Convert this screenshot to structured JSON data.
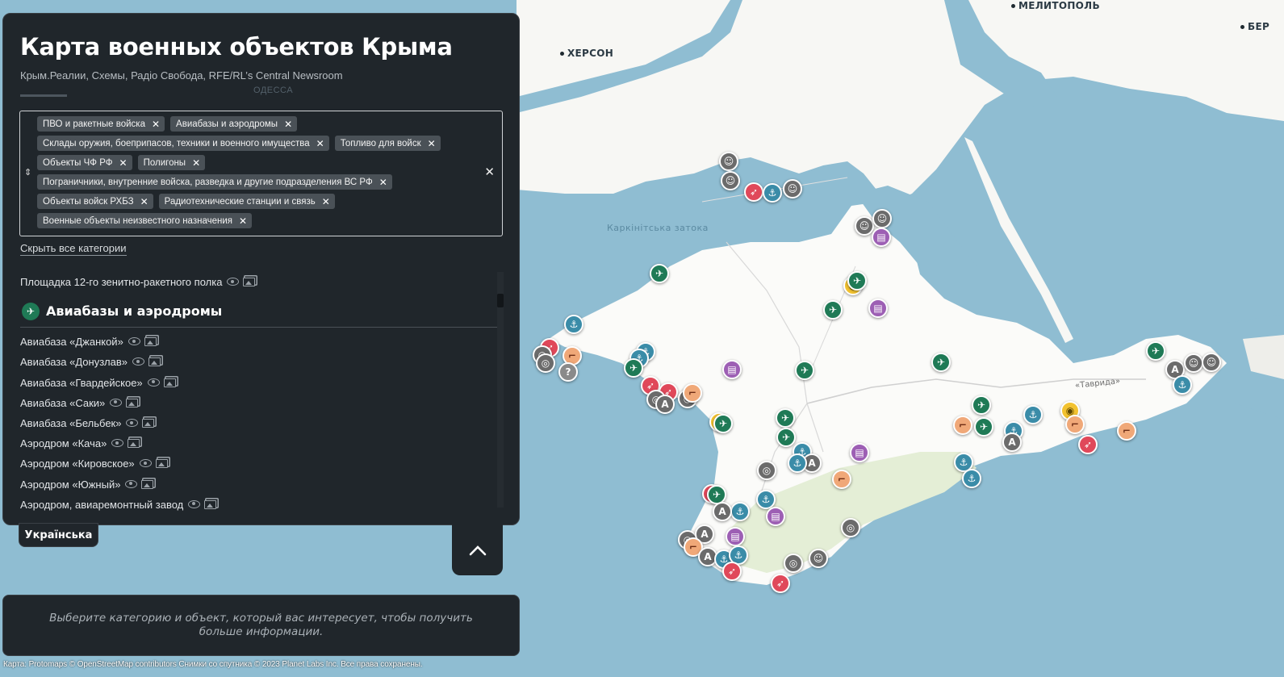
{
  "map": {
    "cities": [
      {
        "name": "ХЕРСОН"
      },
      {
        "name": "МЕЛИТОПОЛЬ"
      },
      {
        "name": "БЕР"
      }
    ],
    "water_label": "Каркінітська затока",
    "road_label": "«Таврида»",
    "marker_categories": {
      "air": {
        "color": "#1f7a56",
        "icon": "plane-icon"
      },
      "navy": {
        "color": "#3a8ca8",
        "icon": "anchor-icon"
      },
      "pvo": {
        "color": "#e0485a",
        "icon": "missile-icon"
      },
      "fuel": {
        "color": "#f0a878",
        "icon": "fuel-gun-icon"
      },
      "border": {
        "color": "#6b6b6b",
        "icon": "soldier-icon"
      },
      "store": {
        "color": "#9d5fb4",
        "icon": "warehouse-icon"
      },
      "unknown": {
        "color": "#8a8a8a",
        "icon": "question-icon"
      }
    }
  },
  "panel": {
    "title": "Карта военных объектов Крыма",
    "subtitle": "Крым.Реалии, Схемы, Радіо Свобода, RFE/RL’s Central Newsroom",
    "ghost_label": "ОДЕССА",
    "chips": [
      "ПВО и ракетные войска",
      "Авиабазы и аэродромы",
      "Склады оружия, боеприпасов, техники и военного имущества",
      "Топливо для войск",
      "Объекты ЧФ РФ",
      "Полигоны",
      "Пограничники, внутренние войска, разведка и другие подразделения ВС РФ",
      "Объекты войск РХБЗ",
      "Радиотехнические станции и связь",
      "Военные объекты неизвестного назначения"
    ],
    "hide_categories": "Скрыть все категории",
    "list": {
      "prev_item": "Площадка 12-го зенитно-ракетного полка",
      "section_title": "Авиабазы и аэродромы",
      "items": [
        "Авиабаза «Джанкой»",
        "Авиабаза «Донузлав»",
        "Авиабаза «Гвардейское»",
        "Авиабаза «Саки»",
        "Авиабаза «Бельбек»",
        "Аэродром «Кача»",
        "Аэродром «Кировское»",
        "Аэродром «Южный»",
        "Аэродром, авиаремонтный завод"
      ]
    }
  },
  "controls": {
    "language": "Українська"
  },
  "info": {
    "text": "Выберите категорию и объект, который вас интересует, чтобы получить больше информации."
  },
  "attribution": "Карта: Protomaps © OpenStreetMap contributors Снимки со спутника © 2023 Planet Labs Inc. Все права сохранены."
}
